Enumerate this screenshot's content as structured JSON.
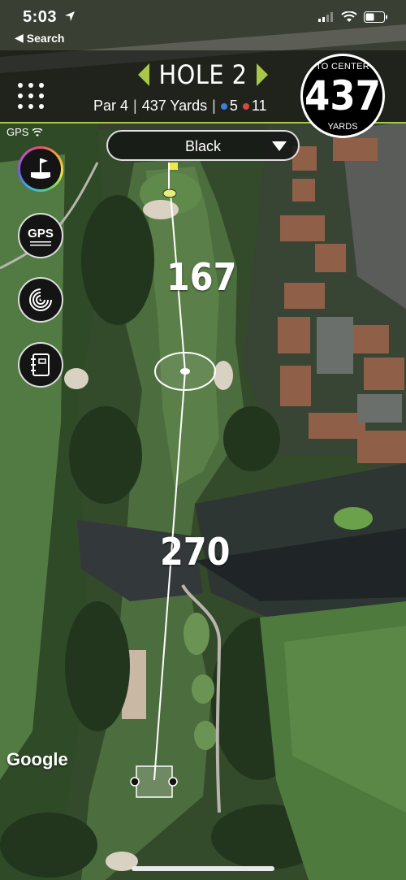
{
  "status_bar": {
    "time": "5:03",
    "back_label": "Search"
  },
  "header": {
    "hole_title": "HOLE 2",
    "par": "Par 4",
    "yards": "437 Yards",
    "blue_count": "5",
    "red_count": "11",
    "colors": {
      "accent": "#a9c84a",
      "blue_dot": "#3d7fd6",
      "red_dot": "#d6483d"
    }
  },
  "distance_circle": {
    "label": "TO CENTER",
    "value": "437",
    "unit": "YARDS"
  },
  "gps_indicator": "GPS",
  "tee_selector": {
    "value": "Black"
  },
  "side_buttons": [
    {
      "name": "hole-overview",
      "icon": "green-flag-icon"
    },
    {
      "name": "gps",
      "icon": "gps-icon",
      "label": "GPS"
    },
    {
      "name": "shot-tracker",
      "icon": "target-rings-icon"
    },
    {
      "name": "scorecard",
      "icon": "notebook-icon"
    }
  ],
  "map": {
    "distance_upper": "167",
    "distance_lower": "270",
    "attribution": "Google"
  }
}
